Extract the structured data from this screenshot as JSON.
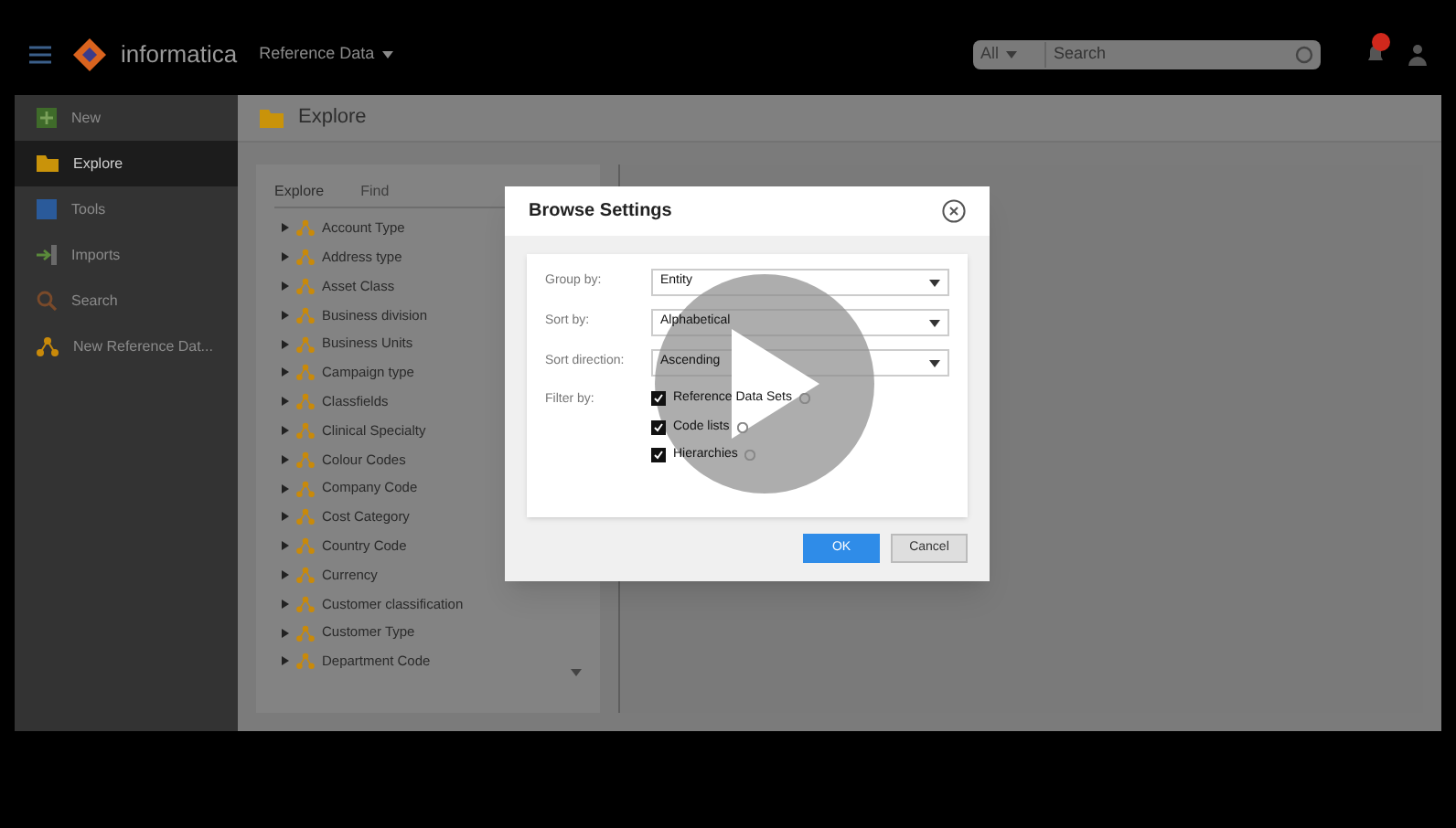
{
  "topbar": {
    "brand": "informatica",
    "app_menu": "Reference Data",
    "search_scope": "All",
    "search_placeholder": "Search",
    "notification": true
  },
  "sidebar": {
    "items": [
      {
        "label": "New",
        "selected": false
      },
      {
        "label": "Explore",
        "selected": true
      },
      {
        "label": "Tools",
        "selected": false
      },
      {
        "label": "Imports",
        "selected": false
      },
      {
        "label": "Search",
        "selected": false
      },
      {
        "label": "New Reference Dat...",
        "selected": false
      }
    ]
  },
  "page_title": "Explore",
  "explore_panel": {
    "title": "Explore",
    "tab": "Find",
    "items": [
      "Account Type",
      "Address type",
      "Asset Class",
      "Business division",
      "Business Units",
      "Campaign type",
      "Classfields",
      "Clinical Specialty",
      "Colour Codes",
      "Company Code",
      "Cost Category",
      "Country Code",
      "Currency",
      "Customer classification",
      "Customer Type",
      "Department Code"
    ]
  },
  "dialog": {
    "title": "Browse Settings",
    "fields": [
      {
        "label": "Group by:",
        "value": "Entity"
      },
      {
        "label": "Sort by:",
        "value": "Alphabetical"
      },
      {
        "label": "Sort direction:",
        "value": "Ascending"
      }
    ],
    "filter_label": "Filter by:",
    "filters": [
      {
        "label": "Reference Data Sets",
        "checked": true
      },
      {
        "label": "Code lists",
        "checked": true
      },
      {
        "label": "Hierarchies",
        "checked": true
      }
    ],
    "buttons": [
      {
        "label": "OK",
        "kind": "primary"
      },
      {
        "label": "Cancel",
        "kind": "secondary"
      }
    ]
  }
}
